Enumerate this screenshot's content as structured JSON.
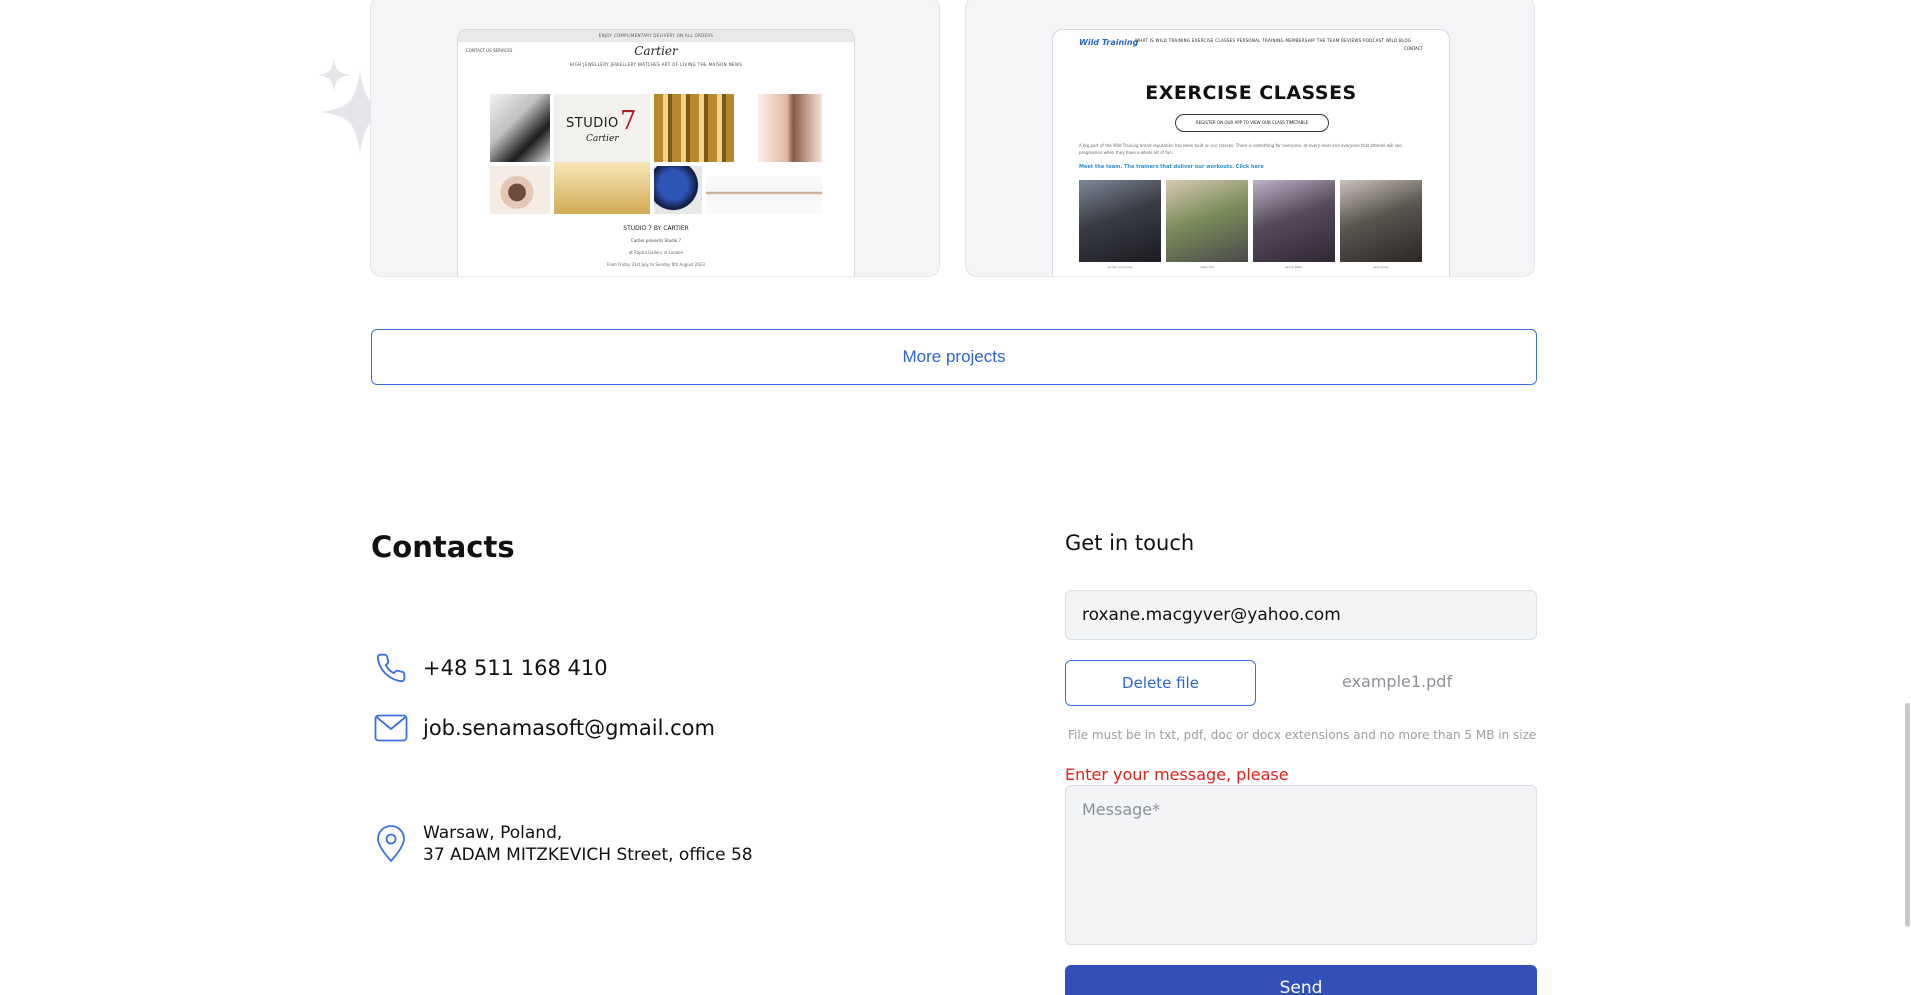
{
  "projects": {
    "card1": {
      "promo": "ENJOY COMPLIMENTARY DELIVERY ON ALL ORDERS",
      "nav_left": "CONTACT US   SERVICES",
      "brand": "Cartier",
      "nav": "HIGH JEWELLERY   JEWELLERY   WATCHES   ART OF LIVING   THE MAISON   NEWS",
      "tile_studio": "STUDIO",
      "tile_seven": "7",
      "tile_cartier": "Cartier",
      "caption": "STUDIO 7 BY CARTIER",
      "caption2": "Cartier presents Studio 7",
      "caption3": "at Rapha Gallery in London",
      "caption4": "From Friday 21st July to Sunday 6th August 2023"
    },
    "card2": {
      "logo": "Wild Training",
      "nav": "WHAT IS WILD TRAINING   EXERCISE CLASSES   PERSONAL TRAINING   MEMBERSHIP   THE TEAM   REVIEWS   PODCAST   WILD BLOG",
      "nav_contact": "CONTACT",
      "title": "EXERCISE CLASSES",
      "cta": "REGISTER ON OUR APP TO VIEW OUR CLASS TIMETABLE",
      "text": "A big part of the Wild Training brand reputation has been built on our classes. There is something for everyone, at every level and everyone that attends will see progression when they have a whole lot of fun.",
      "link": "Meet the team. The trainers that deliver our workouts. Click here",
      "photo_captions": [
        "Jordan Cummins",
        "Abby Hill",
        "Jamie Wells",
        "Jade Knox"
      ]
    }
  },
  "more_projects_label": "More projects",
  "contacts": {
    "title": "Contacts",
    "phone": "+48 511 168 410",
    "email": "job.senamasoft@gmail.com",
    "address_line1": "Warsaw, Poland,",
    "address_line2": "37 ADAM MITZKEVICH Street, office 58"
  },
  "form": {
    "title": "Get in touch",
    "email_value": "roxane.macgyver@yahoo.com",
    "delete_file_label": "Delete file",
    "file_name": "example1.pdf",
    "file_hint": "File must be in txt, pdf, doc or docx extensions and no more than 5 MB in size",
    "message_error": "Enter your message, please",
    "message_placeholder": "Message*",
    "send_label": "Send"
  },
  "colors": {
    "accent": "#2e63d8",
    "button_primary": "#3150b8",
    "error": "#e3201b",
    "field_bg": "#f3f4f6"
  },
  "icons": [
    "sparkle-icon",
    "phone-icon",
    "mail-icon",
    "location-pin-icon"
  ]
}
